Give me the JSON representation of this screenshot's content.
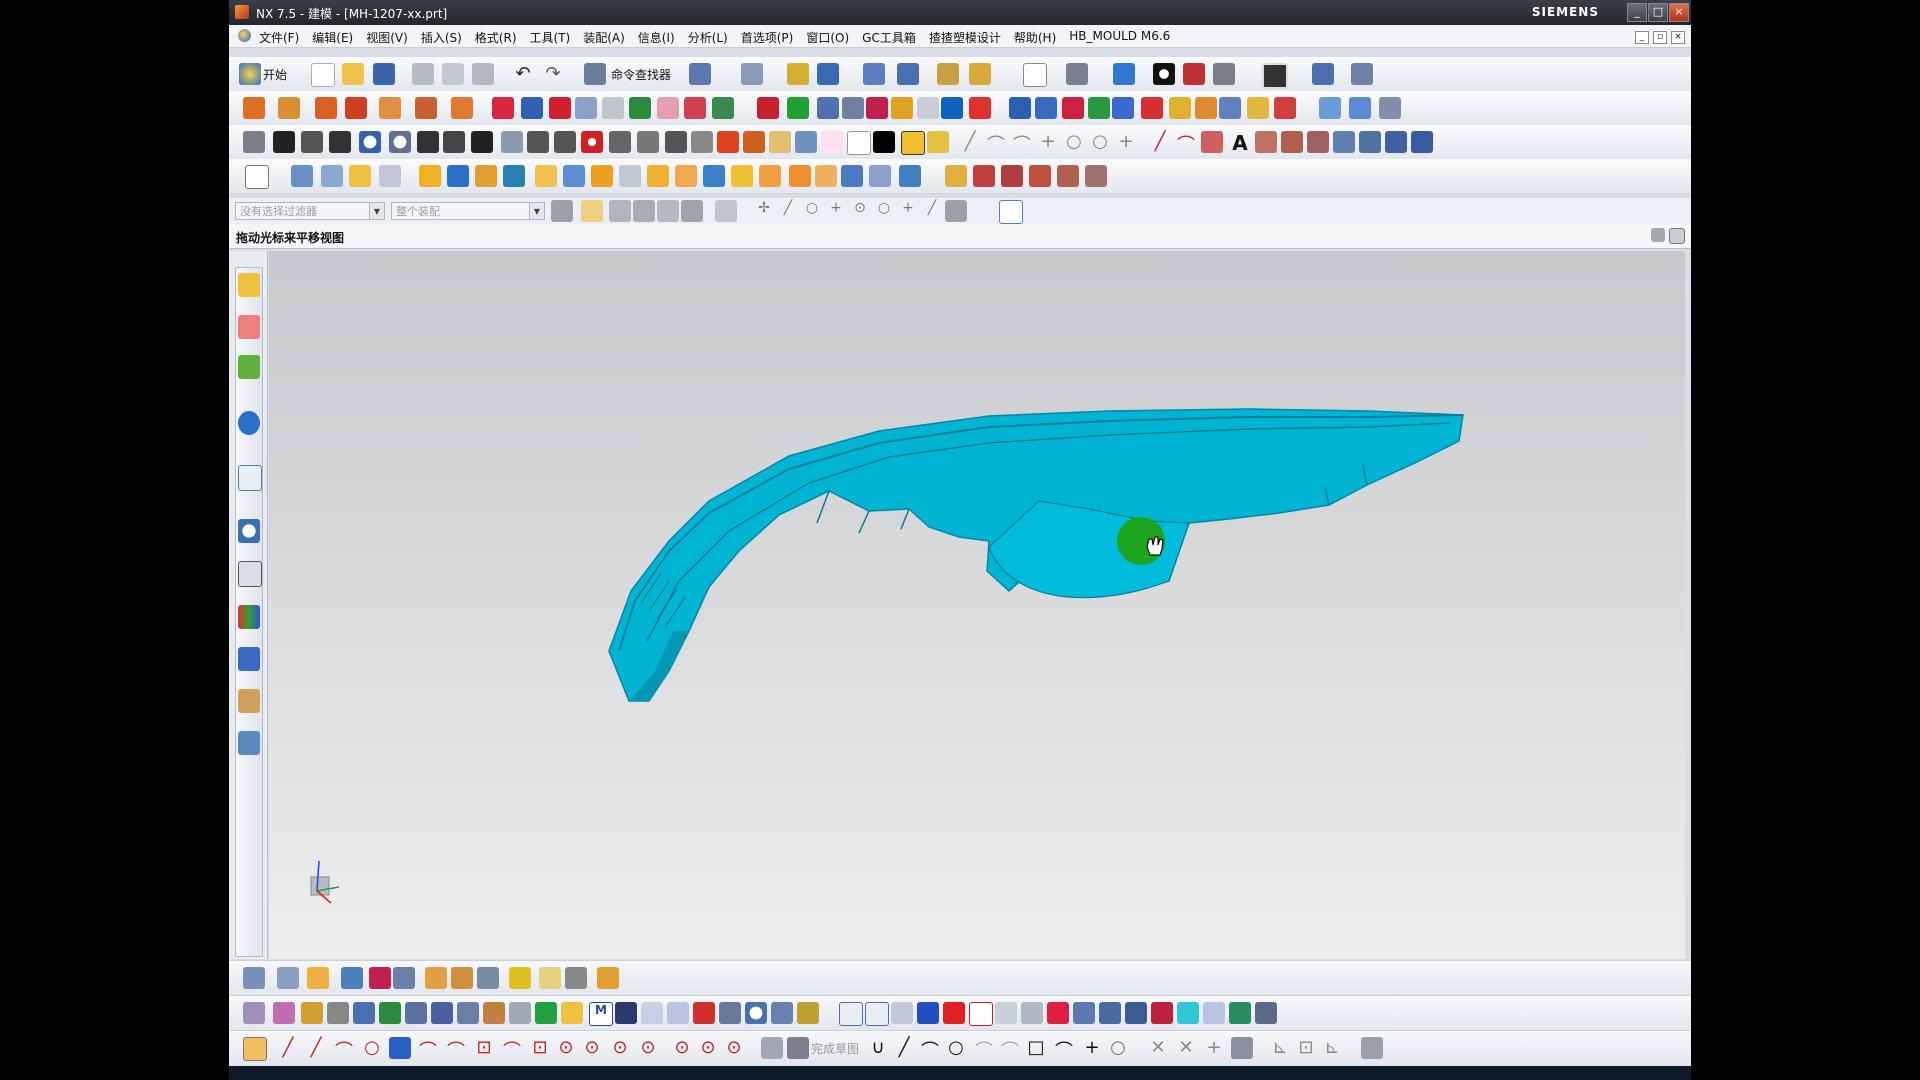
{
  "window": {
    "title": "NX 7.5 - 建模 - [MH-1207-xx.prt]",
    "brand": "SIEMENS",
    "controls": [
      "_",
      "□",
      "×"
    ]
  },
  "menubar": {
    "items": [
      "文件(F)",
      "编辑(E)",
      "视图(V)",
      "插入(S)",
      "格式(R)",
      "工具(T)",
      "装配(A)",
      "信息(I)",
      "分析(L)",
      "首选项(P)",
      "窗口(O)",
      "GC工具箱",
      "揸揸塑模设计",
      "帮助(H)",
      "HB_MOULD M6.6"
    ]
  },
  "toolbar": {
    "start_label": "开始",
    "command_finder_label": "命令查找器"
  },
  "selection_bar": {
    "filter_placeholder": "没有选择过滤器",
    "scope_placeholder": "整个装配"
  },
  "cue_line": {
    "text": "拖动光标来平移视图"
  },
  "bottom_toolbar": {
    "finish_sketch_label": "完成草图"
  },
  "model": {
    "color": "#00b4d4",
    "dark_color": "#0088a6"
  },
  "colors": {
    "titlebar": "#2b2e36",
    "viewport_top": "#c7c9cc",
    "viewport_bottom": "#eeeeef",
    "cursor_highlight": "#1ea51e"
  }
}
